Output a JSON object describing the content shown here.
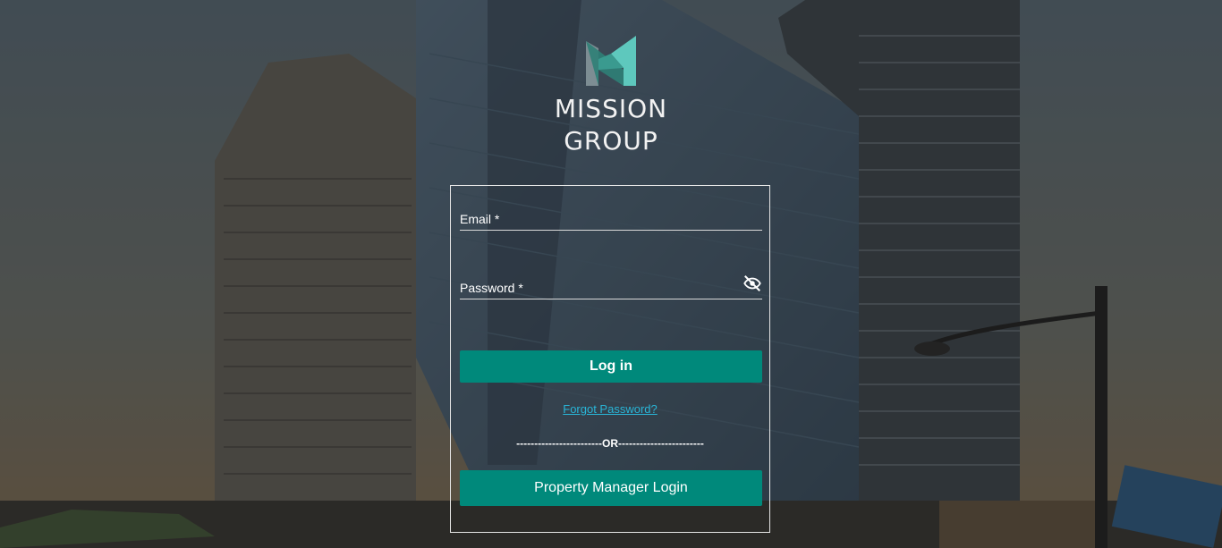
{
  "brand": {
    "name_line1": "MISSION",
    "name_line2": "GROUP",
    "colors": {
      "mark_light": "#5ec8bd",
      "mark_dark": "#2f7f77",
      "mark_gray": "#8a9aa0"
    }
  },
  "form": {
    "email_label": "Email *",
    "email_value": "",
    "password_label": "Password *",
    "password_value": "",
    "password_toggle_icon": "eye-off-icon",
    "login_label": "Log in",
    "forgot_label": "Forgot Password?",
    "divider_text": "------------------------OR------------------------",
    "pm_login_label": "Property Manager Login"
  },
  "colors": {
    "accent": "#00897b",
    "link": "#29b6d8",
    "text": "#ffffff"
  }
}
